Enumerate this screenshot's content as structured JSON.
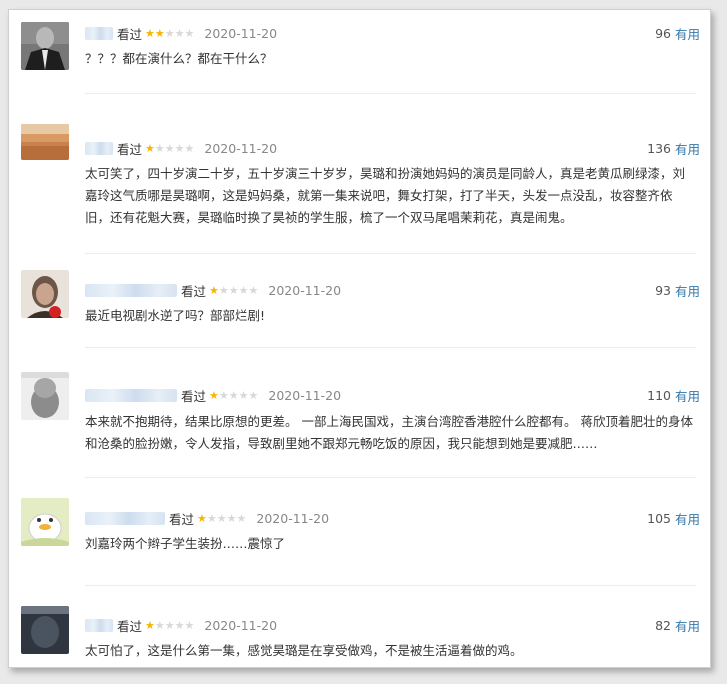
{
  "comments": [
    {
      "watched_label": "看过",
      "rating": 2,
      "date": "2020-11-20",
      "votes": "96",
      "useful_label": "有用",
      "text": "？？？都在演什么？都在干什么？",
      "avatar": "blurred-portrait-suit"
    },
    {
      "watched_label": "看过",
      "rating": 1,
      "date": "2020-11-20",
      "votes": "136",
      "useful_label": "有用",
      "text": "太可笑了，四十岁演二十岁，五十岁演三十岁岁，昊璐和扮演她妈妈的演员是同龄人，真是老黄瓜刷绿漆，刘嘉玲这气质哪是昊璐啊，这是妈妈桑，就第一集来说吧，舞女打架，打了半天，头发一点没乱，妆容整齐依旧，还有花魁大赛，昊璐临时换了昊祯的学生服，梳了一个双马尾唱茉莉花，真是闹鬼。",
      "avatar": "blurred-field"
    },
    {
      "watched_label": "看过",
      "rating": 1,
      "date": "2020-11-20",
      "votes": "93",
      "useful_label": "有用",
      "text": "最近电视剧水逆了吗？部部烂剧!",
      "avatar": "blurred-girl-red"
    },
    {
      "watched_label": "看过",
      "rating": 1,
      "date": "2020-11-20",
      "votes": "110",
      "useful_label": "有用",
      "text": "本来就不抱期待，结果比原想的更差。 一部上海民国戏，主演台湾腔香港腔什么腔都有。 蒋欣顶着肥壮的身体和沧桑的脸扮嫩，令人发指，导致剧里她不跟郑元畅吃饭的原因，我只能想到她是要减肥……",
      "avatar": "blurred-grey-pet"
    },
    {
      "watched_label": "看过",
      "rating": 1,
      "date": "2020-11-20",
      "votes": "105",
      "useful_label": "有用",
      "text": "刘嘉玲两个辫子学生装扮……震惊了",
      "avatar": "cartoon-duck"
    },
    {
      "watched_label": "看过",
      "rating": 1,
      "date": "2020-11-20",
      "votes": "82",
      "useful_label": "有用",
      "text": "太可怕了，这是什么第一集，感觉昊璐是在享受做鸡，不是被生活逼着做的鸡。",
      "avatar": "blurred-dark"
    }
  ],
  "colors": {
    "link": "#3377aa",
    "star_on": "#f7b500",
    "star_off": "#d8d8d8",
    "text": "#333333",
    "date": "#888888"
  }
}
